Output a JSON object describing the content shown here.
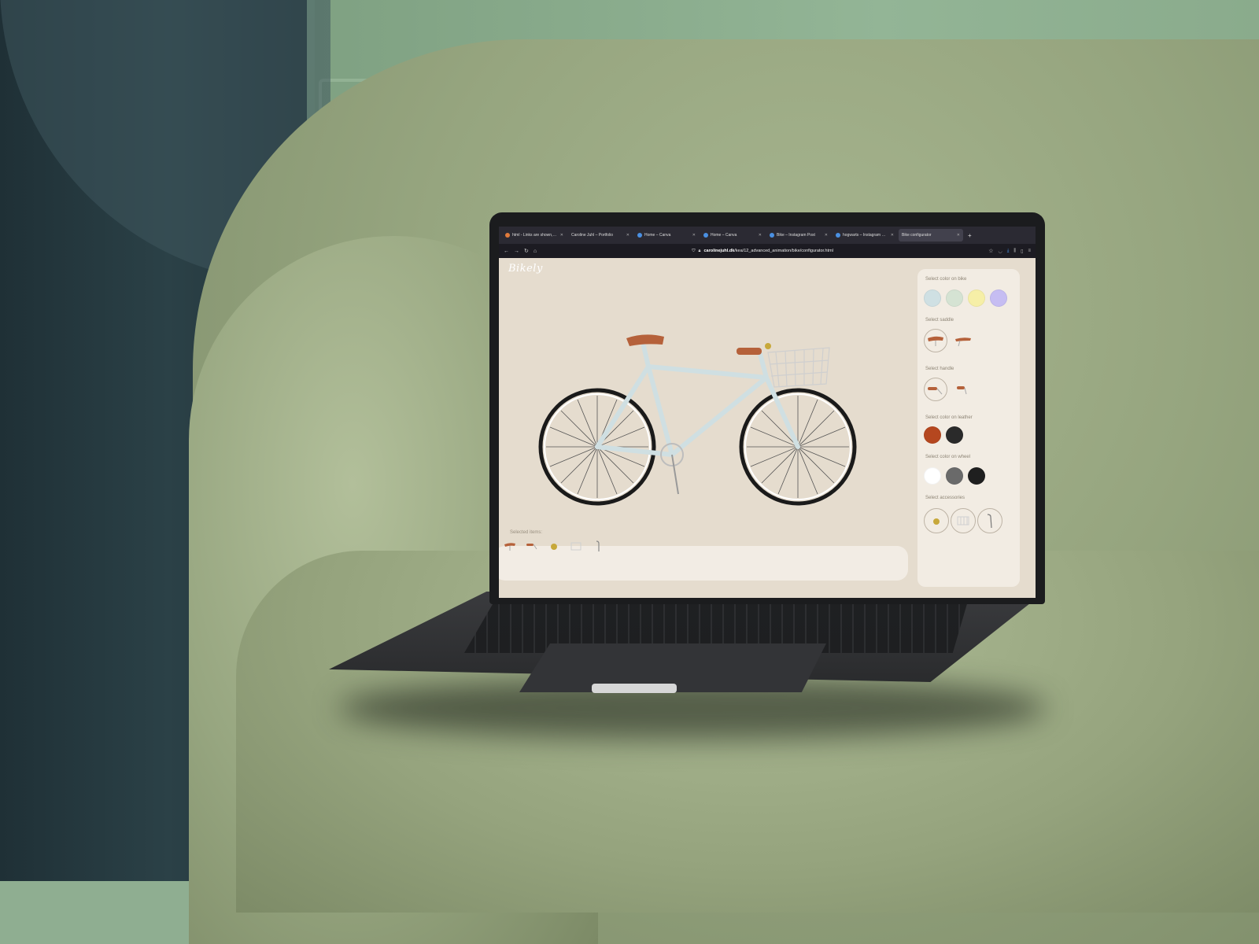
{
  "browser": {
    "tabs": [
      {
        "label": "html - Links are shown, but yo...",
        "favicon": "orange-favicon",
        "active": false
      },
      {
        "label": "Caroline Juhl – Portfolio",
        "favicon": "globe-favicon",
        "active": false
      },
      {
        "label": "Home – Canva",
        "favicon": "canva-favicon",
        "active": false
      },
      {
        "label": "Home – Canva",
        "favicon": "canva-favicon",
        "active": false
      },
      {
        "label": "Bike – Instagram Post",
        "favicon": "canva-favicon",
        "active": false
      },
      {
        "label": "hogwarts – Instagram Post",
        "favicon": "canva-favicon",
        "active": false
      },
      {
        "label": "Bike configurator",
        "favicon": "none",
        "active": true
      }
    ],
    "new_tab": "+",
    "url_domain": "carolinejuhl.dk",
    "url_path": "/kea/12_advanced_animation/bike/configurator.html",
    "nav": {
      "back": "←",
      "forward": "→",
      "reload": "↻",
      "home": "⌂"
    }
  },
  "page": {
    "logo": "Bikely",
    "selected_items_label": "Selected items:",
    "panel": {
      "bike_color_label": "Select color on bike",
      "bike_colors": [
        "#cfe0e3",
        "#d5e3d3",
        "#f6efa7",
        "#c6bdf2"
      ],
      "saddle_label": "Select saddle",
      "handle_label": "Select handle",
      "leather_color_label": "Select color on leather",
      "leather_colors": [
        "#b5471f",
        "#2a2a2a"
      ],
      "wheel_color_label": "Select color on wheel",
      "wheel_colors": [
        "#ffffff",
        "#6a6a6a",
        "#1f1f1f"
      ],
      "accessories_label": "Select accessories"
    }
  },
  "colors": {
    "frame": "#cfdfe2",
    "leather": "#b5613a",
    "page_bg": "#e5dcce",
    "panel_bg": "#f2ece3"
  }
}
